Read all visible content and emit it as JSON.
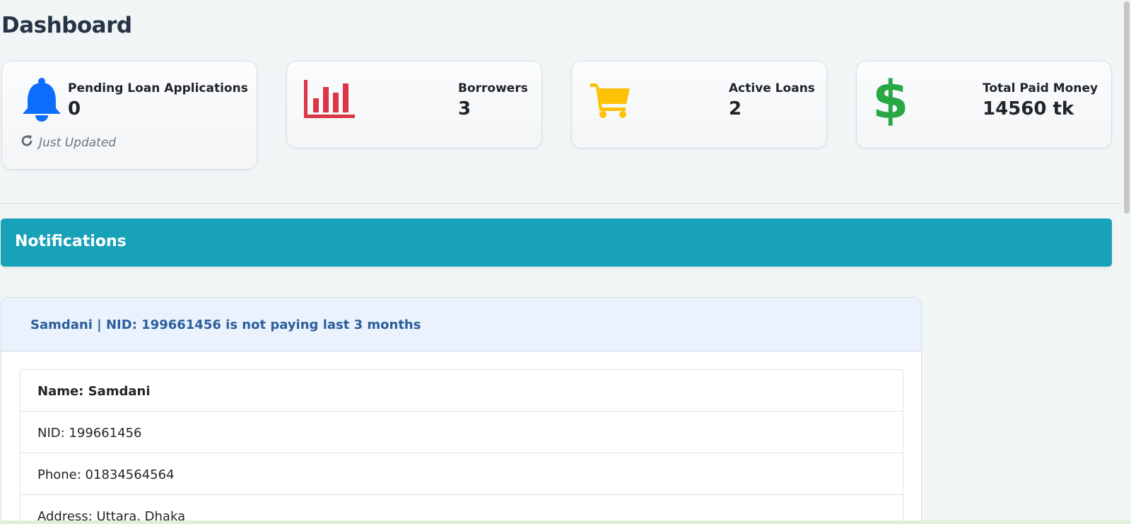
{
  "page": {
    "title": "Dashboard"
  },
  "cards": {
    "pending": {
      "label": "Pending Loan Applications",
      "value": "0",
      "status": "Just Updated",
      "icon": "bell-icon",
      "icon_color": "#0d6efd"
    },
    "borrowers": {
      "label": "Borrowers",
      "value": "3",
      "icon": "bar-chart-icon",
      "icon_color": "#dc3545"
    },
    "active_loans": {
      "label": "Active Loans",
      "value": "2",
      "icon": "shopping-cart-icon",
      "icon_color": "#ffc107"
    },
    "total_paid": {
      "label": "Total Paid Money",
      "value": "14560 tk",
      "icon": "dollar-icon",
      "icon_color": "#28a745"
    }
  },
  "notifications": {
    "title": "Notifications",
    "bar_color": "#17a2b8",
    "items": [
      {
        "header": "Samdani | NID: 199661456 is not paying last 3 months",
        "name": "Name: Samdani",
        "nid": "NID: 199661456",
        "phone": "Phone: 01834564564",
        "address": "Address: Uttara, Dhaka"
      }
    ]
  }
}
